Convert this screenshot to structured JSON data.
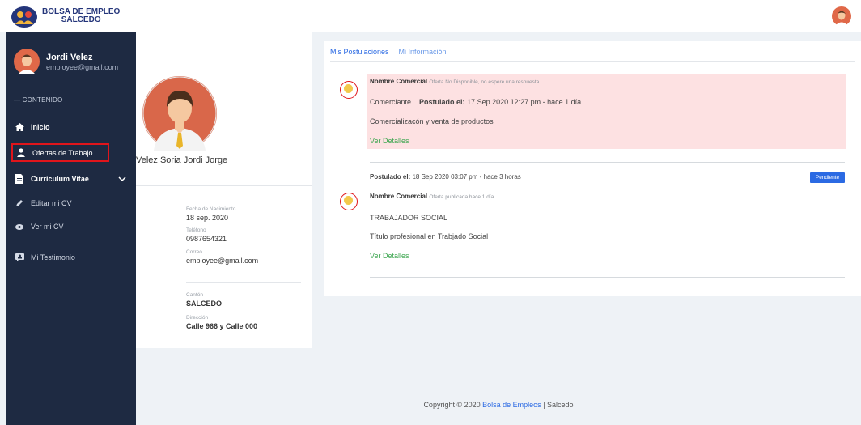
{
  "brand": {
    "line1": "BOLSA DE EMPLEO",
    "line2": "SALCEDO",
    "logo_icon": "brand-logo-icon"
  },
  "sidebar": {
    "user_name": "Jordi Velez",
    "user_email": "employee@gmail.com",
    "section_label": "— CONTENIDO",
    "items": [
      {
        "label": "Inicio",
        "icon": "home-icon"
      },
      {
        "label": "Ofertas de Trabajo",
        "icon": "user-icon"
      },
      {
        "label": "Curriculum Vitae",
        "icon": "document-icon"
      },
      {
        "label": "Editar mi CV",
        "icon": "pencil-icon"
      },
      {
        "label": "Ver mi CV",
        "icon": "eye-icon"
      },
      {
        "label": "Mi Testimonio",
        "icon": "testimonial-icon"
      }
    ]
  },
  "profile": {
    "full_name": "Velez Soria Jordi Jorge",
    "birth_label": "Fecha de Nacimiento",
    "birth_value": "18 sep. 2020",
    "phone_label": "Teléfono",
    "phone_value": "0987654321",
    "email_label": "Correo",
    "email_value": "employee@gmail.com",
    "canton_label": "Cantón",
    "canton_value": "SALCEDO",
    "address_label": "Dirección",
    "address_value": "Calle 966 y Calle 000"
  },
  "tabs": [
    {
      "label": "Mis Postulaciones"
    },
    {
      "label": "Mi Información"
    }
  ],
  "postulations": [
    {
      "company": "Nombre Comercial",
      "company_note": "Oferta No Disponible, no espere una respuesta",
      "position": "Comerciante",
      "applied_label": "Postulado el:",
      "applied_value": "17 Sep 2020 12:27 pm - hace 1 día",
      "description": "Comercializacón y venta de productos",
      "details_link": "Ver Detalles"
    },
    {
      "header_label": "Postulado el:",
      "header_value": "18 Sep 2020 03:07 pm - hace 3 horas",
      "status": "Pendiente",
      "company": "Nombre Comercial",
      "company_note": "Oferta publicada hace 1 día",
      "position": "TRABAJADOR SOCIAL",
      "description": "Título profesional en Trabjado Social",
      "details_link": "Ver Detalles"
    }
  ],
  "footer": {
    "prefix": "Copyright © 2020",
    "link": "Bolsa de Empleos",
    "suffix": "| Salcedo"
  },
  "colors": {
    "sidebar_bg": "#1e2a42",
    "accent_blue": "#2b6ae3",
    "link_green": "#3ba54e",
    "unavailable_bg": "#fde1e2",
    "highlight_red": "#e0151b"
  }
}
